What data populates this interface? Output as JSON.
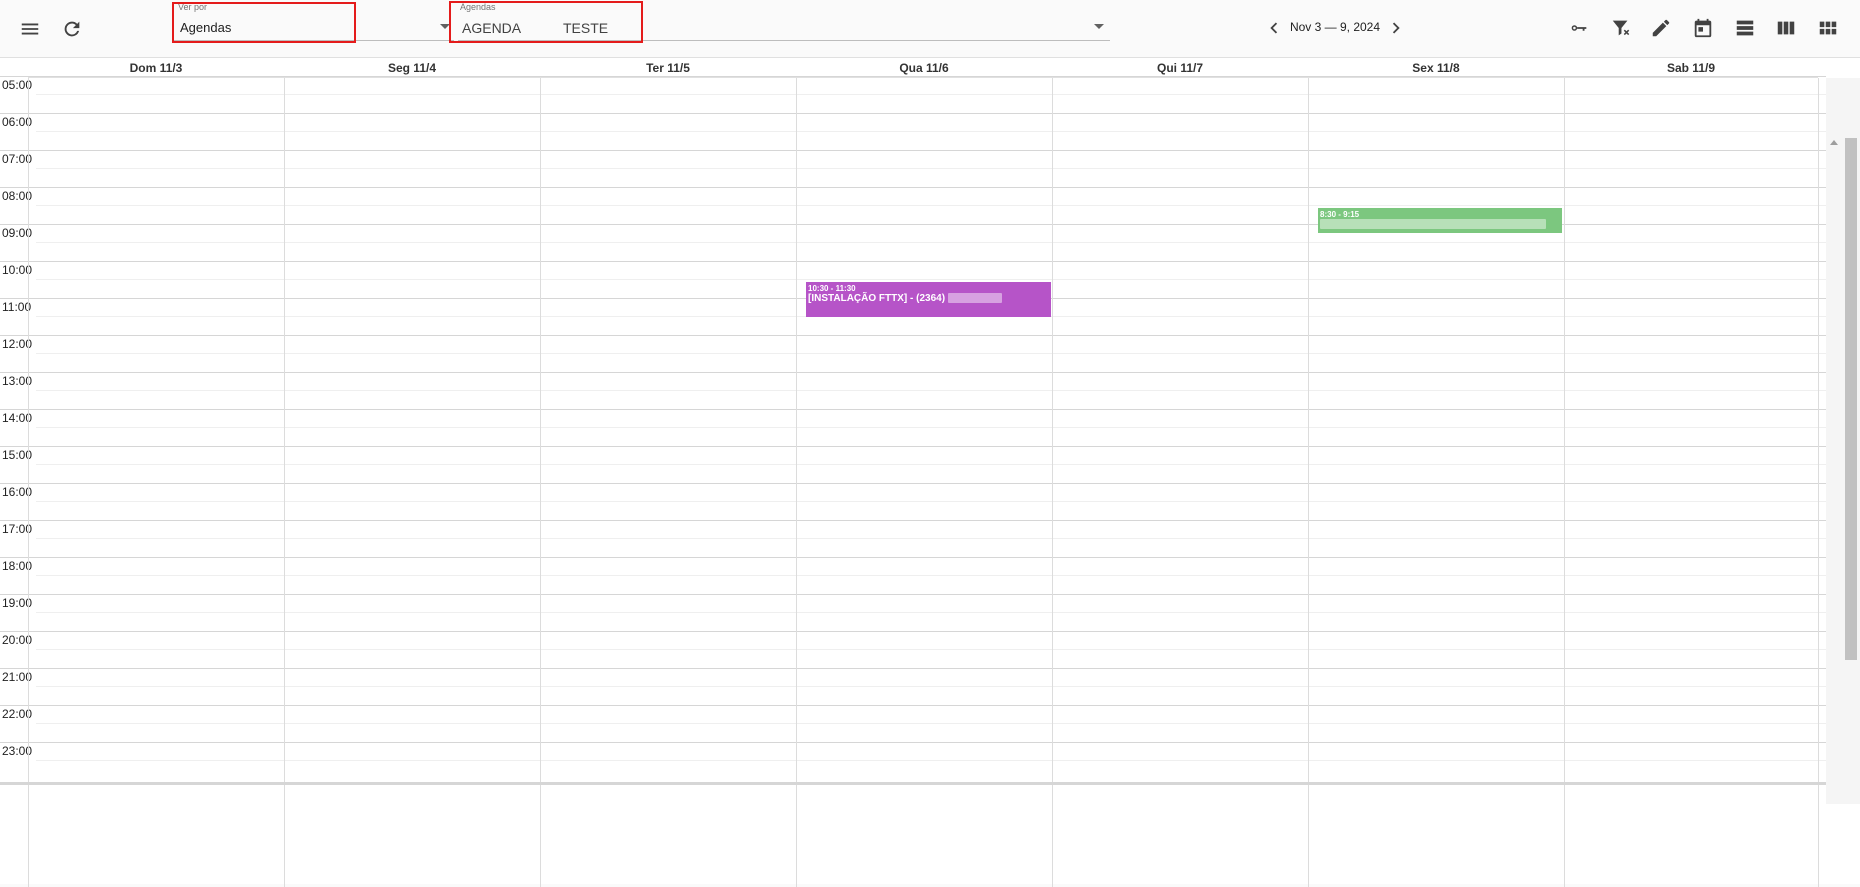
{
  "toolbar": {
    "menu_icon": "menu-icon",
    "refresh_icon": "refresh-icon",
    "view_by": {
      "label": "Ver por",
      "value": "Agendas"
    },
    "agendas": {
      "label": "Agendas",
      "value_part1": "AGENDA",
      "value_part2": "TESTE"
    },
    "date_range": "Nov 3 — 9, 2024",
    "right_icons": [
      "key-icon",
      "filter-clear-icon",
      "edit-icon",
      "calendar-icon",
      "day-view-icon",
      "week-view-icon",
      "month-view-icon"
    ]
  },
  "calendar": {
    "days": [
      "Dom 11/3",
      "Seg 11/4",
      "Ter 11/5",
      "Qua 11/6",
      "Qui 11/7",
      "Sex 11/8",
      "Sab 11/9"
    ],
    "hours": [
      "05:00",
      "06:00",
      "07:00",
      "08:00",
      "09:00",
      "10:00",
      "11:00",
      "12:00",
      "13:00",
      "14:00",
      "15:00",
      "16:00",
      "17:00",
      "18:00",
      "19:00",
      "20:00",
      "21:00",
      "22:00",
      "23:00"
    ],
    "events": [
      {
        "time": "10:30 - 11:30",
        "title": "[INSTALAÇÃO FTTX] - (2364)",
        "color": "#b654c8"
      },
      {
        "time": "8:30 - 9:15",
        "title": "",
        "color": "#7cc77f"
      }
    ]
  },
  "colors": {
    "highlight": "#e41b1b"
  }
}
